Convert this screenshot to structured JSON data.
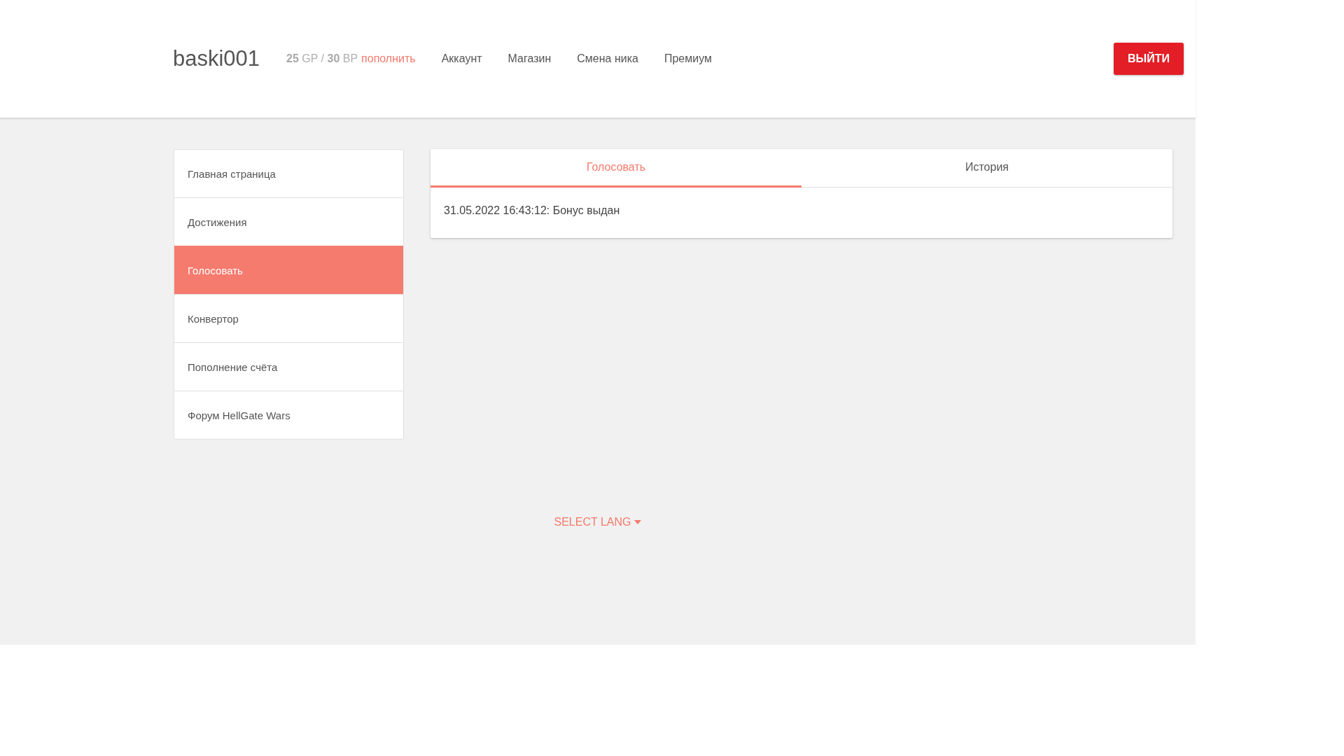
{
  "header": {
    "username": "baski001",
    "balance": "**25** GP / **30** BP",
    "topup_link": "пополнить",
    "nav": [
      "Аккаунт",
      "Магазин",
      "Смена ника",
      "Премиум"
    ],
    "logout": "ВЫЙТИ"
  },
  "sidebar": {
    "items": [
      {
        "label": "Главная страница",
        "selected": false
      },
      {
        "label": "Достижения",
        "selected": false
      },
      {
        "label": "Голосовать",
        "selected": true
      },
      {
        "label": "Конвертор",
        "selected": false
      },
      {
        "label": "Пополнение счёта",
        "selected": false
      },
      {
        "label": "Форум HellGate Wars",
        "selected": false
      }
    ]
  },
  "panel": {
    "tabs": [
      {
        "label": "Голосовать",
        "selected": true
      },
      {
        "label": "История",
        "selected": false
      }
    ],
    "entries": [
      "31.05.2022 16:43:12: Бонус выдан"
    ]
  },
  "footer": {
    "lang_select": "SELECT LANG"
  }
}
